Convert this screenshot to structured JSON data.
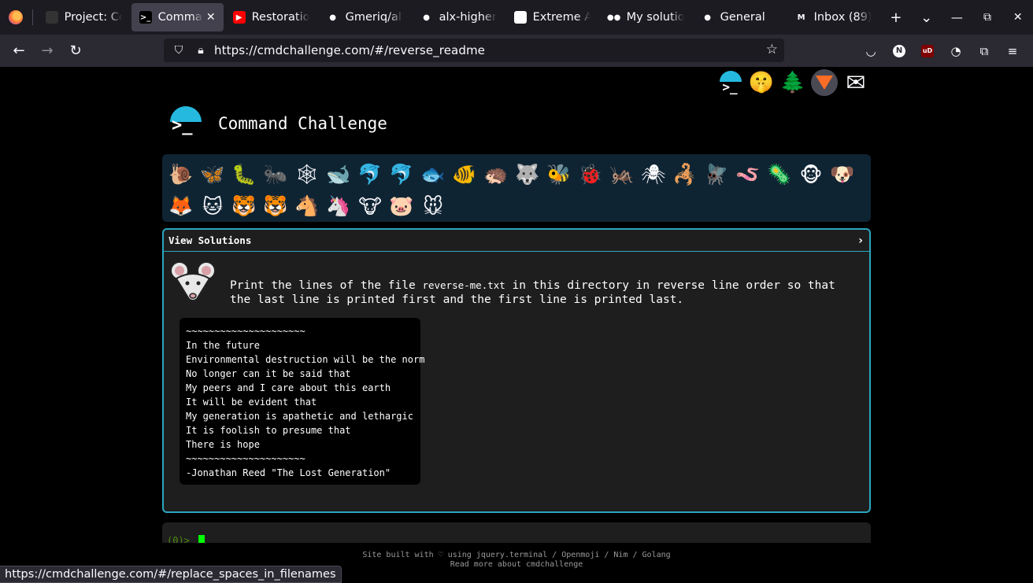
{
  "browser": {
    "tabs": [
      {
        "title": "Project: Co",
        "fav": "",
        "fav_color": "#333333"
      },
      {
        "title": "Comman",
        "fav": ">_",
        "fav_color": "#000000",
        "active": true
      },
      {
        "title": "Restoration",
        "fav": "▶",
        "fav_color": "#ff0000"
      },
      {
        "title": "Gmeriq/alx",
        "fav": "●",
        "fav_color": "#1c1b22"
      },
      {
        "title": "alx-higher_",
        "fav": "●",
        "fav_color": "#1c1b22"
      },
      {
        "title": "Extreme Av",
        "fav": "◼",
        "fav_color": "#ffffff"
      },
      {
        "title": "My solutio",
        "fav": "●●",
        "fav_color": "#1c1b22"
      },
      {
        "title": "General",
        "fav": "●",
        "fav_color": "#1c1b22"
      },
      {
        "title": "Inbox (89)",
        "fav": "M",
        "fav_color": "#1c1b22"
      }
    ],
    "close_glyph": "✕",
    "new_tab": "+",
    "list_tabs": "⌄",
    "restore": "⧉",
    "close_window": "✕",
    "url": "https://cmdchallenge.com/#/reverse_readme",
    "extensions": {
      "n_badge": "N",
      "ub_badge": "uD"
    }
  },
  "page": {
    "brand_title": "Command Challenge",
    "logo_symbol": ">_",
    "top_icons": [
      "terminal-icon",
      "shushing-face-icon",
      "tree-icon",
      "gitlab-icon",
      "envelope-icon"
    ],
    "top_icon_glyphs": {
      "shh": "🤫",
      "tree": "🌲",
      "mail": "✉"
    },
    "animals": [
      "🐌",
      "🦋",
      "🐛",
      "🐜",
      "🕸",
      "🐋",
      "🐬",
      "🐬",
      "🐟",
      "🐠",
      "🦔",
      "🐺",
      "🐝",
      "🐞",
      "🦗",
      "🕷",
      "🦂",
      "🪰",
      "🪱",
      "🦠",
      "🐵",
      "🐶",
      "🦊",
      "🐱",
      "🐯",
      "🐯",
      "🐴",
      "🦄",
      "🐮",
      "🐷",
      "🐭"
    ],
    "card": {
      "header": "View Solutions",
      "chevron": "›",
      "task_before": "Print the lines of the file ",
      "task_file": "reverse-me.txt",
      "task_after": " in this directory in reverse line order so that the last line is printed first and the first line is printed last.",
      "poem": "~~~~~~~~~~~~~~~~~~~~~\nIn the future\nEnvironmental destruction will be the norm\nNo longer can it be said that\nMy peers and I care about this earth\nIt will be evident that\nMy generation is apathetic and lethargic\nIt is foolish to presume that\nThere is hope\n~~~~~~~~~~~~~~~~~~~~~\n-Jonathan Reed \"The Lost Generation\""
    },
    "terminal": {
      "prompt": "(0)> "
    },
    "footer": {
      "line1": "Site built with ♡ using jquery.terminal / Openmoji / Nim / Golang",
      "line2": "Read more about cmdchallenge"
    }
  },
  "status_url": "https://cmdchallenge.com/#/replace_spaces_in_filenames",
  "colors": {
    "accent": "#2aa6bf",
    "brand_arc": "#26b9e0",
    "cursor": "#00ff00"
  }
}
